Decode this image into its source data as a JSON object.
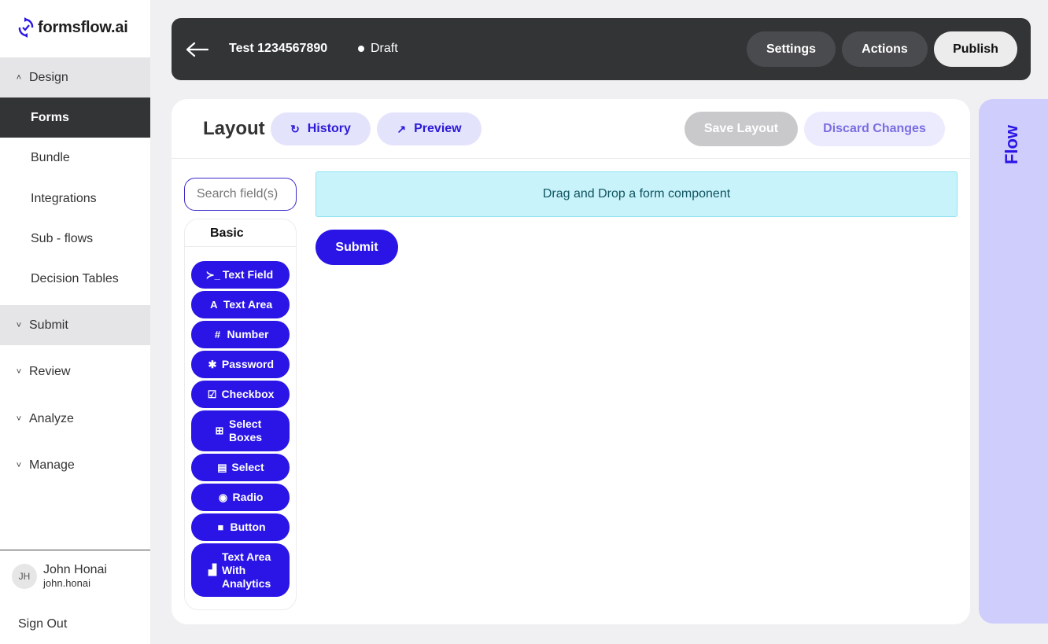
{
  "app": {
    "name": "formsflow.ai",
    "logo_icon": "formsflow-sync-icon"
  },
  "sidebar": {
    "sections": [
      {
        "label": "Design",
        "expanded": true
      },
      {
        "label": "Submit",
        "expanded": false
      },
      {
        "label": "Review",
        "expanded": false
      },
      {
        "label": "Analyze",
        "expanded": false
      },
      {
        "label": "Manage",
        "expanded": false
      }
    ],
    "design_items": [
      {
        "label": "Forms",
        "active": true
      },
      {
        "label": "Bundle"
      },
      {
        "label": "Integrations"
      },
      {
        "label": "Sub - flows"
      },
      {
        "label": "Decision Tables"
      }
    ],
    "user": {
      "initials": "JH",
      "name": "John Honai",
      "handle": "john.honai"
    },
    "sign_out": "Sign Out"
  },
  "header": {
    "form_name": "Test 1234567890",
    "status": "Draft",
    "buttons": {
      "settings": "Settings",
      "actions": "Actions",
      "publish": "Publish"
    }
  },
  "layout": {
    "title": "Layout",
    "history": "History",
    "preview": "Preview",
    "save": "Save Layout",
    "discard": "Discard Changes",
    "search_placeholder": "Search field(s)",
    "palette_title": "Basic",
    "components": [
      {
        "label": "Text Field",
        "icon": "terminal-icon",
        "glyph": "≻_"
      },
      {
        "label": "Text Area",
        "icon": "font-icon",
        "glyph": "A"
      },
      {
        "label": "Number",
        "icon": "hash-icon",
        "glyph": "#"
      },
      {
        "label": "Password",
        "icon": "asterisk-icon",
        "glyph": "✱"
      },
      {
        "label": "Checkbox",
        "icon": "checkbox-icon",
        "glyph": "☑"
      },
      {
        "label": "Select Boxes",
        "icon": "plus-square-icon",
        "glyph": "⊞"
      },
      {
        "label": "Select",
        "icon": "list-icon",
        "glyph": "▤"
      },
      {
        "label": "Radio",
        "icon": "radio-icon",
        "glyph": "◉"
      },
      {
        "label": "Button",
        "icon": "stop-icon",
        "glyph": "■"
      },
      {
        "label": "Text Area With Analytics",
        "icon": "chart-icon",
        "glyph": "▟"
      }
    ],
    "dropzone_text": "Drag and Drop a form component",
    "submit": "Submit"
  },
  "flow_panel": {
    "label": "Flow"
  },
  "colors": {
    "primary": "#2a15e6",
    "dark": "#333436",
    "dropzone": "#c8f3fb",
    "flow_bg": "#cfcdfb"
  }
}
